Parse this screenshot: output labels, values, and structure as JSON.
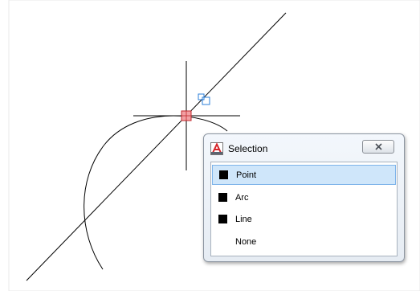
{
  "dialog": {
    "title": "Selection",
    "options": [
      {
        "label": "Point",
        "selected": true
      },
      {
        "label": "Arc",
        "selected": false
      },
      {
        "label": "Line",
        "selected": false
      },
      {
        "label": "None",
        "selected": false
      }
    ]
  },
  "colors": {
    "selection_highlight": "#cfe6fa",
    "snap_marker": "#e0565a",
    "grip_marker": "#2b7fd9",
    "app_icon": "#d7262b"
  }
}
